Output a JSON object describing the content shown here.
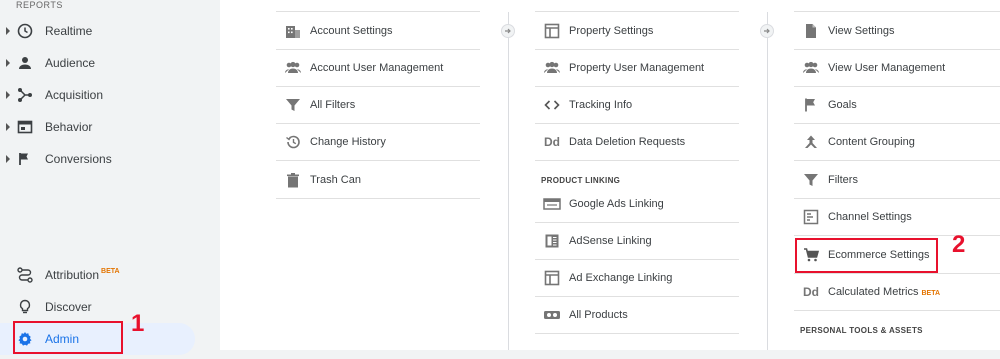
{
  "sidebar": {
    "section_label": "REPORTS",
    "items": [
      {
        "label": "Realtime",
        "icon": "clock-icon"
      },
      {
        "label": "Audience",
        "icon": "person-icon"
      },
      {
        "label": "Acquisition",
        "icon": "acquisition-icon"
      },
      {
        "label": "Behavior",
        "icon": "behavior-icon"
      },
      {
        "label": "Conversions",
        "icon": "flag-icon"
      }
    ],
    "bottom_items": [
      {
        "label": "Attribution",
        "badge": "BETA",
        "icon": "attribution-icon"
      },
      {
        "label": "Discover",
        "icon": "lightbulb-icon"
      },
      {
        "label": "Admin",
        "icon": "gear-icon"
      }
    ]
  },
  "account_column": {
    "items": [
      {
        "label": "Account Settings",
        "icon": "building-icon"
      },
      {
        "label": "Account User Management",
        "icon": "people-icon"
      },
      {
        "label": "All Filters",
        "icon": "filter-icon"
      },
      {
        "label": "Change History",
        "icon": "history-icon"
      },
      {
        "label": "Trash Can",
        "icon": "trash-icon"
      }
    ]
  },
  "property_column": {
    "items": [
      {
        "label": "Property Settings",
        "icon": "window-icon"
      },
      {
        "label": "Property User Management",
        "icon": "people-icon"
      },
      {
        "label": "Tracking Info",
        "icon": "code-icon"
      },
      {
        "label": "Data Deletion Requests",
        "icon": "dd-icon",
        "icon_text": "Dd"
      }
    ],
    "section_label": "PRODUCT LINKING",
    "linking_items": [
      {
        "label": "Google Ads Linking",
        "icon": "ads-icon"
      },
      {
        "label": "AdSense Linking",
        "icon": "adsense-icon"
      },
      {
        "label": "Ad Exchange Linking",
        "icon": "adexchange-icon"
      },
      {
        "label": "All Products",
        "icon": "link-icon"
      }
    ]
  },
  "view_column": {
    "items": [
      {
        "label": "View Settings",
        "icon": "document-icon"
      },
      {
        "label": "View User Management",
        "icon": "people-icon"
      },
      {
        "label": "Goals",
        "icon": "flag-icon"
      },
      {
        "label": "Content Grouping",
        "icon": "grouping-icon"
      },
      {
        "label": "Filters",
        "icon": "filter-icon"
      },
      {
        "label": "Channel Settings",
        "icon": "channel-icon"
      },
      {
        "label": "Ecommerce Settings",
        "icon": "cart-icon"
      },
      {
        "label": "Calculated Metrics",
        "badge": "BETA",
        "icon": "dd-icon",
        "icon_text": "Dd"
      }
    ],
    "section_label": "PERSONAL TOOLS & ASSETS"
  },
  "annotations": {
    "marker_1": "1",
    "marker_2": "2"
  },
  "colors": {
    "highlight": "#e8112d",
    "admin_active": "#1a73e8",
    "beta": "#e37400"
  }
}
